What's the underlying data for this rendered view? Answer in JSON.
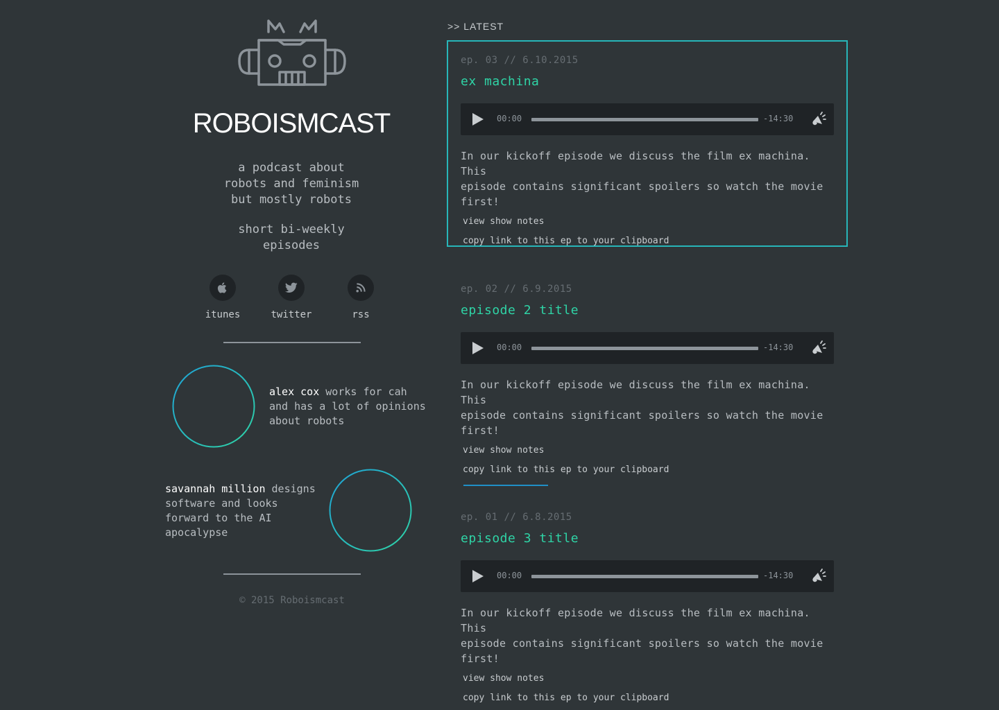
{
  "site": {
    "title": "ROBOISMCAST",
    "tagline_lines": [
      "a podcast about",
      "robots and feminism",
      "but mostly robots"
    ],
    "schedule_lines": [
      "short bi-weekly",
      "episodes"
    ],
    "footer": "© 2015 Roboismcast"
  },
  "social": [
    {
      "label": "itunes",
      "icon": "apple-icon"
    },
    {
      "label": "twitter",
      "icon": "twitter-icon"
    },
    {
      "label": "rss",
      "icon": "rss-icon"
    }
  ],
  "hosts": [
    {
      "name": "alex cox",
      "bio_lines": [
        " works for cah",
        "and has a lot of opinions",
        "about robots"
      ]
    },
    {
      "name": "savannah million",
      "bio_lines": [
        " designs",
        "software and looks",
        "forward to the AI",
        "apocalypse"
      ]
    }
  ],
  "section_label": ">> LATEST",
  "episodes": [
    {
      "meta": "ep. 03 // 6.10.2015",
      "title": "ex machina",
      "player": {
        "current": "00:00",
        "remaining": "-14:30"
      },
      "description_lines": [
        "In our kickoff episode we discuss the film ex machina. This",
        "episode contains significant spoilers so watch the movie",
        "first!"
      ],
      "notes_link": "view show notes",
      "copy_link": "copy link to this ep to your clipboard"
    },
    {
      "meta": "ep. 02 // 6.9.2015",
      "title": "episode 2 title",
      "player": {
        "current": "00:00",
        "remaining": "-14:30"
      },
      "description_lines": [
        "In our kickoff episode we discuss the film ex machina. This",
        "episode contains significant spoilers so watch the movie",
        "first!"
      ],
      "notes_link": "view show notes",
      "copy_link": "copy link to this ep to your clipboard"
    },
    {
      "meta": "ep. 01 // 6.8.2015",
      "title": "episode 3 title",
      "player": {
        "current": "00:00",
        "remaining": "-14:30"
      },
      "description_lines": [
        "In our kickoff episode we discuss the film ex machina. This",
        "episode contains significant spoilers so watch the movie",
        "first!"
      ],
      "notes_link": "view show notes",
      "copy_link": "copy link to this ep to your clipboard"
    }
  ],
  "colors": {
    "background": "#2f3538",
    "accent_teal": "#27b6b9",
    "title_green": "#2fd4a6",
    "divider_blue": "#1f8fc7"
  }
}
